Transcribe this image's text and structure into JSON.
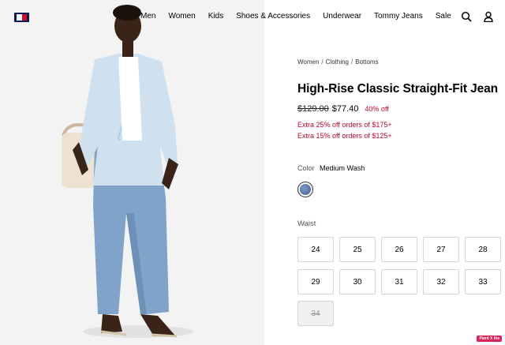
{
  "header": {
    "nav": [
      "Men",
      "Women",
      "Kids",
      "Shoes & Accessories",
      "Underwear",
      "Tommy Jeans",
      "Sale"
    ]
  },
  "breadcrumb": [
    "Women",
    "Clothing",
    "Bottoms"
  ],
  "product": {
    "title": "High-Rise Classic Straight-Fit Jean",
    "price_original": "$129.00",
    "price_sale": "$77.40",
    "discount": "40% off",
    "promos": [
      "Extra 25% off orders of $175+",
      "Extra 15% off orders of $125+"
    ],
    "color_label": "Color",
    "color_value": "Medium Wash",
    "waist_label": "Waist",
    "sizes": [
      {
        "label": "24",
        "available": true
      },
      {
        "label": "25",
        "available": true
      },
      {
        "label": "26",
        "available": true
      },
      {
        "label": "27",
        "available": true
      },
      {
        "label": "28",
        "available": true
      },
      {
        "label": "29",
        "available": true
      },
      {
        "label": "30",
        "available": true
      },
      {
        "label": "31",
        "available": true
      },
      {
        "label": "32",
        "available": true
      },
      {
        "label": "33",
        "available": true
      },
      {
        "label": "34",
        "available": false
      }
    ]
  },
  "badge": "Paint X lite",
  "colors": {
    "sale_red": "#c0082c",
    "navy": "#0b1c5a"
  }
}
